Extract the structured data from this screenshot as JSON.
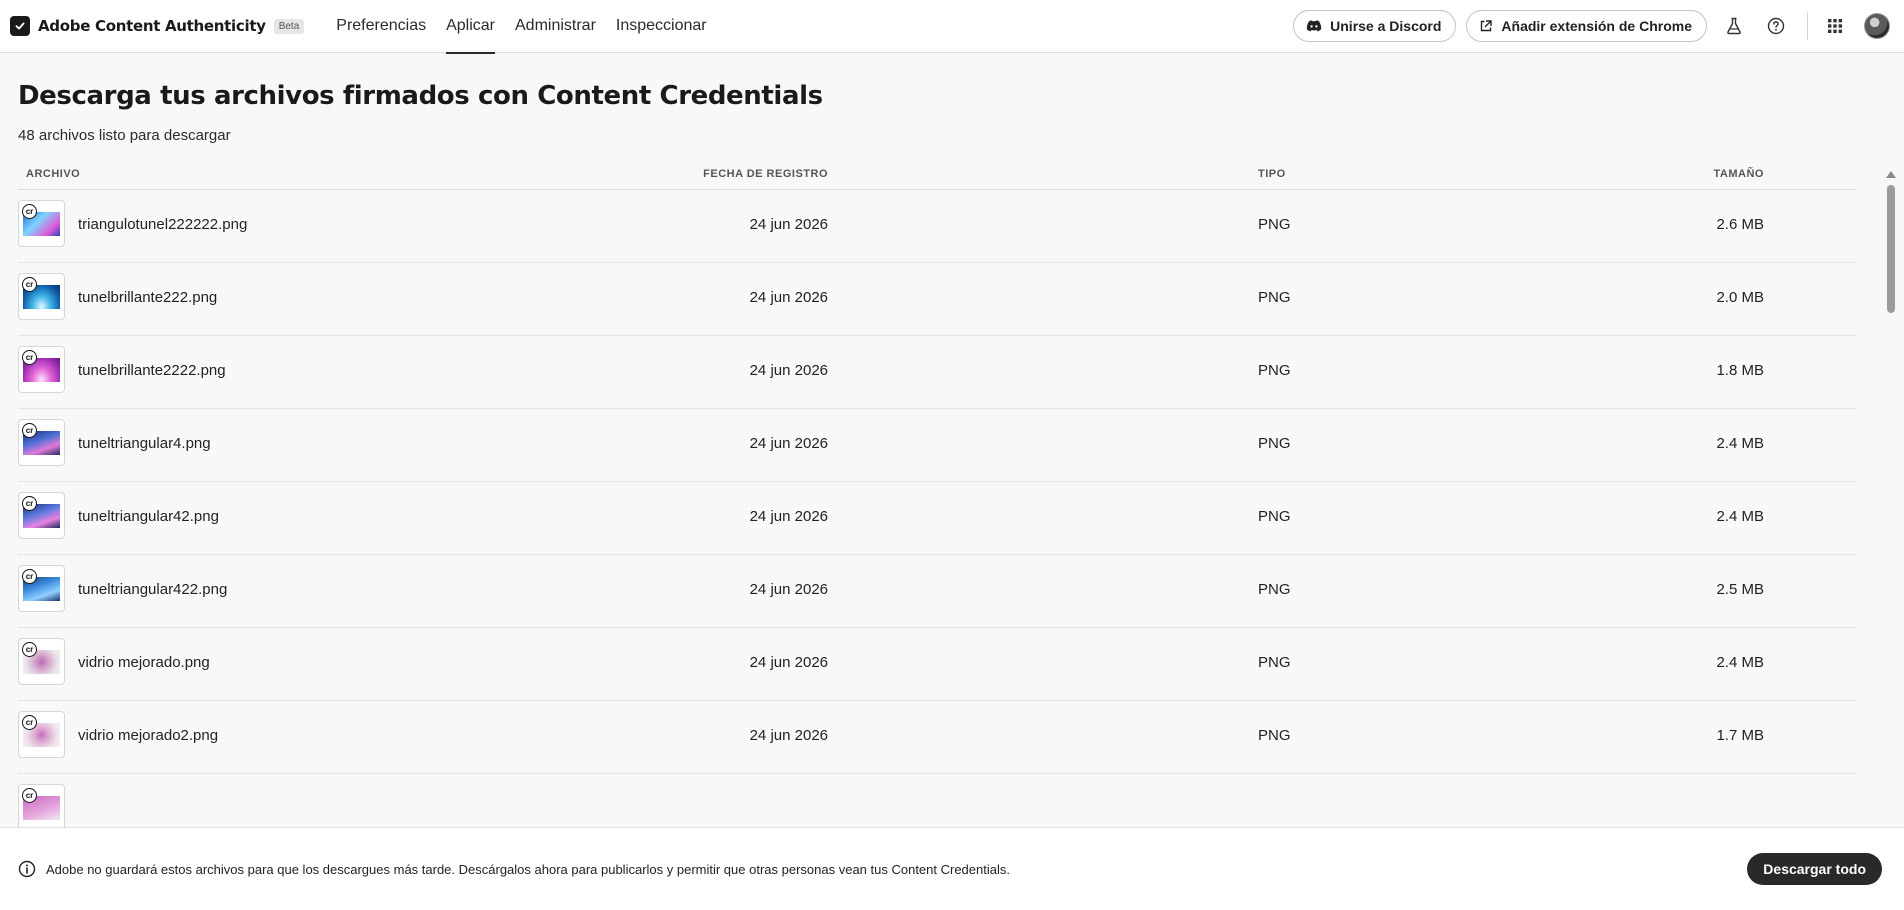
{
  "header": {
    "brand_name": "Adobe Content Authenticity",
    "beta_label": "Beta",
    "nav": [
      {
        "label": "Preferencias",
        "active": false
      },
      {
        "label": "Aplicar",
        "active": true
      },
      {
        "label": "Administrar",
        "active": false
      },
      {
        "label": "Inspeccionar",
        "active": false
      }
    ],
    "discord_label": "Unirse a Discord",
    "chrome_label": "Añadir extensión de Chrome"
  },
  "main": {
    "title": "Descarga tus archivos firmados con Content Credentials",
    "subtitle": "48 archivos listo para descargar"
  },
  "table": {
    "headers": {
      "name": "ARCHIVO",
      "date": "FECHA DE REGISTRO",
      "type": "TIPO",
      "size": "TAMAÑO"
    },
    "rows": [
      {
        "name": "triangulotunel222222.png",
        "date": "24 jun 2026",
        "type": "PNG",
        "size": "2.6 MB"
      },
      {
        "name": "tunelbrillante222.png",
        "date": "24 jun 2026",
        "type": "PNG",
        "size": "2.0 MB"
      },
      {
        "name": "tunelbrillante2222.png",
        "date": "24 jun 2026",
        "type": "PNG",
        "size": "1.8 MB"
      },
      {
        "name": "tuneltriangular4.png",
        "date": "24 jun 2026",
        "type": "PNG",
        "size": "2.4 MB"
      },
      {
        "name": "tuneltriangular42.png",
        "date": "24 jun 2026",
        "type": "PNG",
        "size": "2.4 MB"
      },
      {
        "name": "tuneltriangular422.png",
        "date": "24 jun 2026",
        "type": "PNG",
        "size": "2.5 MB"
      },
      {
        "name": "vidrio mejorado.png",
        "date": "24 jun 2026",
        "type": "PNG",
        "size": "2.4 MB"
      },
      {
        "name": "vidrio mejorado2.png",
        "date": "24 jun 2026",
        "type": "PNG",
        "size": "1.7 MB"
      },
      {
        "name": "",
        "date": "",
        "type": "",
        "size": ""
      }
    ],
    "badge_text": "cr"
  },
  "footer": {
    "notice": "Adobe no guardará estos archivos para que los descargues más tarde. Descárgalos ahora para publicarlos y permitir que otras personas vean tus Content Credentials.",
    "download_all_label": "Descargar todo"
  },
  "icons": {
    "brand": "content-authenticity-logo-icon",
    "discord": "discord-icon",
    "chrome": "external-link-icon",
    "labs": "flask-icon",
    "help": "help-icon",
    "apps": "app-grid-icon",
    "info": "info-icon"
  }
}
